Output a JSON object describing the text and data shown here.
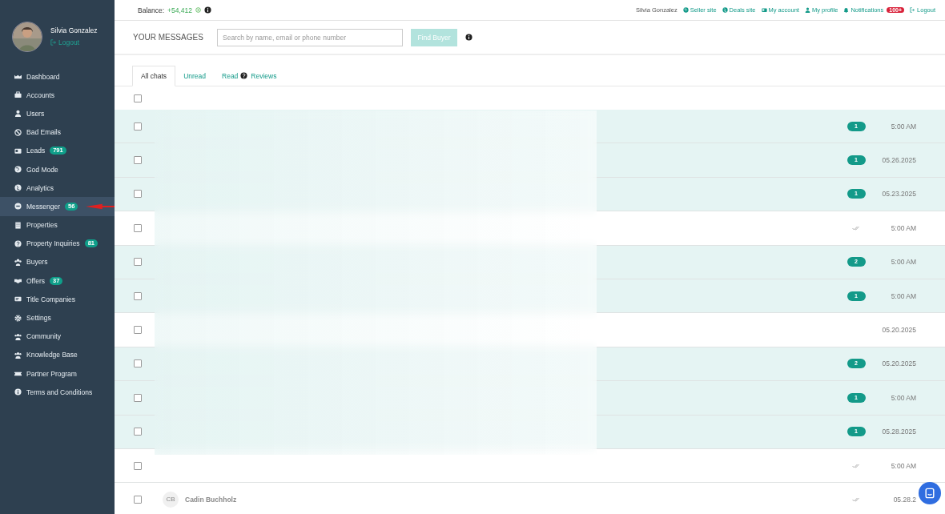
{
  "sidebar": {
    "user": {
      "name": "Silvia Gonzalez",
      "logout": "Logout"
    },
    "items": [
      {
        "label": "Dashboard",
        "selected": false
      },
      {
        "label": "Accounts",
        "selected": false
      },
      {
        "label": "Users",
        "selected": false
      },
      {
        "label": "Bad Emails",
        "selected": false
      },
      {
        "label": "Leads",
        "badge": "791",
        "selected": false
      },
      {
        "label": "God Mode",
        "selected": false
      },
      {
        "label": "Analytics",
        "selected": false
      },
      {
        "label": "Messenger",
        "badge": "56",
        "selected": true
      },
      {
        "label": "Properties",
        "selected": false
      },
      {
        "label": "Property Inquiries",
        "badge": "81",
        "selected": false
      },
      {
        "label": "Buyers",
        "selected": false
      },
      {
        "label": "Offers",
        "badge": "37",
        "selected": false
      },
      {
        "label": "Title Companies",
        "selected": false
      },
      {
        "label": "Settings",
        "selected": false
      },
      {
        "label": "Community",
        "selected": false
      },
      {
        "label": "Knowledge Base",
        "selected": false
      },
      {
        "label": "Partner Program",
        "selected": false
      },
      {
        "label": "Terms and Conditions",
        "selected": false
      }
    ]
  },
  "top_bar": {
    "balance_label": "Balance:",
    "balance_value": "+54,412",
    "user_name": "Silvia Gonzalez",
    "links": [
      {
        "label": "Seller site"
      },
      {
        "label": "Deals site"
      },
      {
        "label": "My account"
      },
      {
        "label": "My profile"
      },
      {
        "label": "Notifications",
        "badge": "100+"
      },
      {
        "label": "Logout"
      }
    ]
  },
  "messages_header": {
    "title": "YOUR MESSAGES",
    "search": {
      "placeholder": "Search by name, email or phone number"
    },
    "button": "Find Buyer"
  },
  "tabs": [
    {
      "label": "All chats",
      "selected": true
    },
    {
      "label": "Unread",
      "selected": false
    },
    {
      "label": "Read",
      "selected": false
    },
    {
      "label": "Reviews",
      "selected": false
    }
  ],
  "select_all": {
    "checked": false
  },
  "chats": [
    {
      "unread": true,
      "count": "1",
      "time": "5:00 AM",
      "checked": false
    },
    {
      "unread": true,
      "count": "1",
      "time": "05.26.2025",
      "checked": false
    },
    {
      "unread": true,
      "count": "1",
      "time": "05.23.2025",
      "checked": false
    },
    {
      "unread": false,
      "read": true,
      "time": "5:00 AM",
      "checked": false
    },
    {
      "unread": true,
      "count": "2",
      "time": "5:00 AM",
      "checked": false
    },
    {
      "unread": true,
      "count": "1",
      "time": "5:00 AM",
      "checked": false
    },
    {
      "unread": false,
      "time": "05.20.2025",
      "checked": false
    },
    {
      "unread": true,
      "count": "2",
      "time": "05.20.2025",
      "checked": false
    },
    {
      "unread": true,
      "count": "1",
      "time": "5:00 AM",
      "checked": false
    },
    {
      "unread": true,
      "count": "1",
      "time": "05.28.2025",
      "checked": false
    },
    {
      "unread": false,
      "read": true,
      "time": "5:00 AM",
      "checked": false
    },
    {
      "unread": false,
      "read": true,
      "time": "05.28.2",
      "initials": "CB",
      "name": "Cadin Buchholz",
      "checked": false
    }
  ]
}
